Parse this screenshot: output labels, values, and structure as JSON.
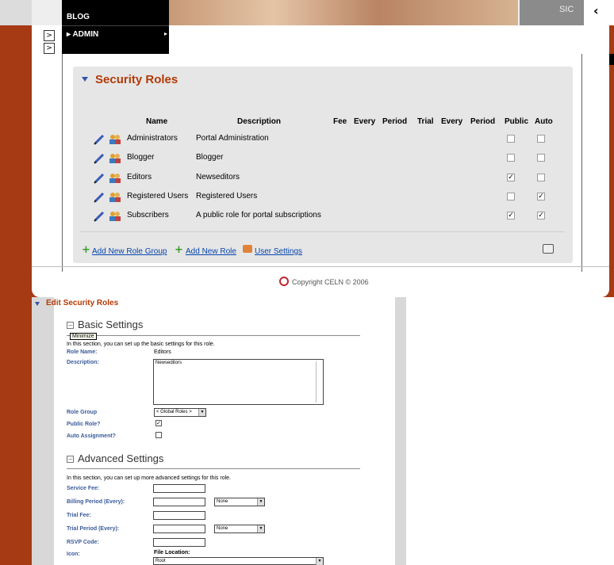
{
  "top_menu": {
    "blog": "BLOG",
    "admin": "ADMIN",
    "nav_text": "SIC",
    "back": "‹"
  },
  "side_buttons": [
    ">",
    ">"
  ],
  "security_roles": {
    "title": "Security Roles",
    "headers": [
      "Name",
      "Description",
      "Fee",
      "Every",
      "Period",
      "Trial",
      "Every",
      "Period",
      "Public",
      "Auto"
    ],
    "rows": [
      {
        "name": "Administrators",
        "description": "Portal Administration",
        "public": false,
        "auto": false
      },
      {
        "name": "Blogger",
        "description": "Blogger",
        "public": false,
        "auto": false
      },
      {
        "name": "Editors",
        "description": "Newseditors",
        "public": true,
        "auto": false
      },
      {
        "name": "Registered Users",
        "description": "Registered Users",
        "public": false,
        "auto": true
      },
      {
        "name": "Subscribers",
        "description": "A public role for portal subscriptions",
        "public": true,
        "auto": true
      }
    ],
    "links": {
      "add_group": "Add New Role Group",
      "add_role": "Add New Role",
      "user_settings": "User Settings"
    }
  },
  "footer": {
    "copyright": "Copyright CELN © 2006"
  },
  "edit": {
    "title": "Edit Security Roles",
    "basic_title": "Basic Settings",
    "tooltip": "Minimize",
    "basic_intro": "In this section, you can set up the basic settings for this role.",
    "role_name_label": "Role Name:",
    "role_name_value": "Editors",
    "description_label": "Description:",
    "description_value": "Newseditors",
    "role_group_label": "Role Group",
    "role_group_value": "< Global Roles >",
    "public_label": "Public Role?",
    "auto_label": "Auto Assignment?",
    "advanced_title": "Advanced Settings",
    "advanced_intro": "In this section, you can set up more advanced settings for this role.",
    "service_fee_label": "Service Fee:",
    "billing_period_label": "Billing Period (Every):",
    "billing_unit": "None",
    "trial_fee_label": "Trial Fee:",
    "trial_period_label": "Trial Period (Every):",
    "trial_unit": "None",
    "rsvp_label": "RSVP Code:",
    "icon_label": "Icon:",
    "file_location_label": "File Location:",
    "file_location_value": "Root"
  }
}
